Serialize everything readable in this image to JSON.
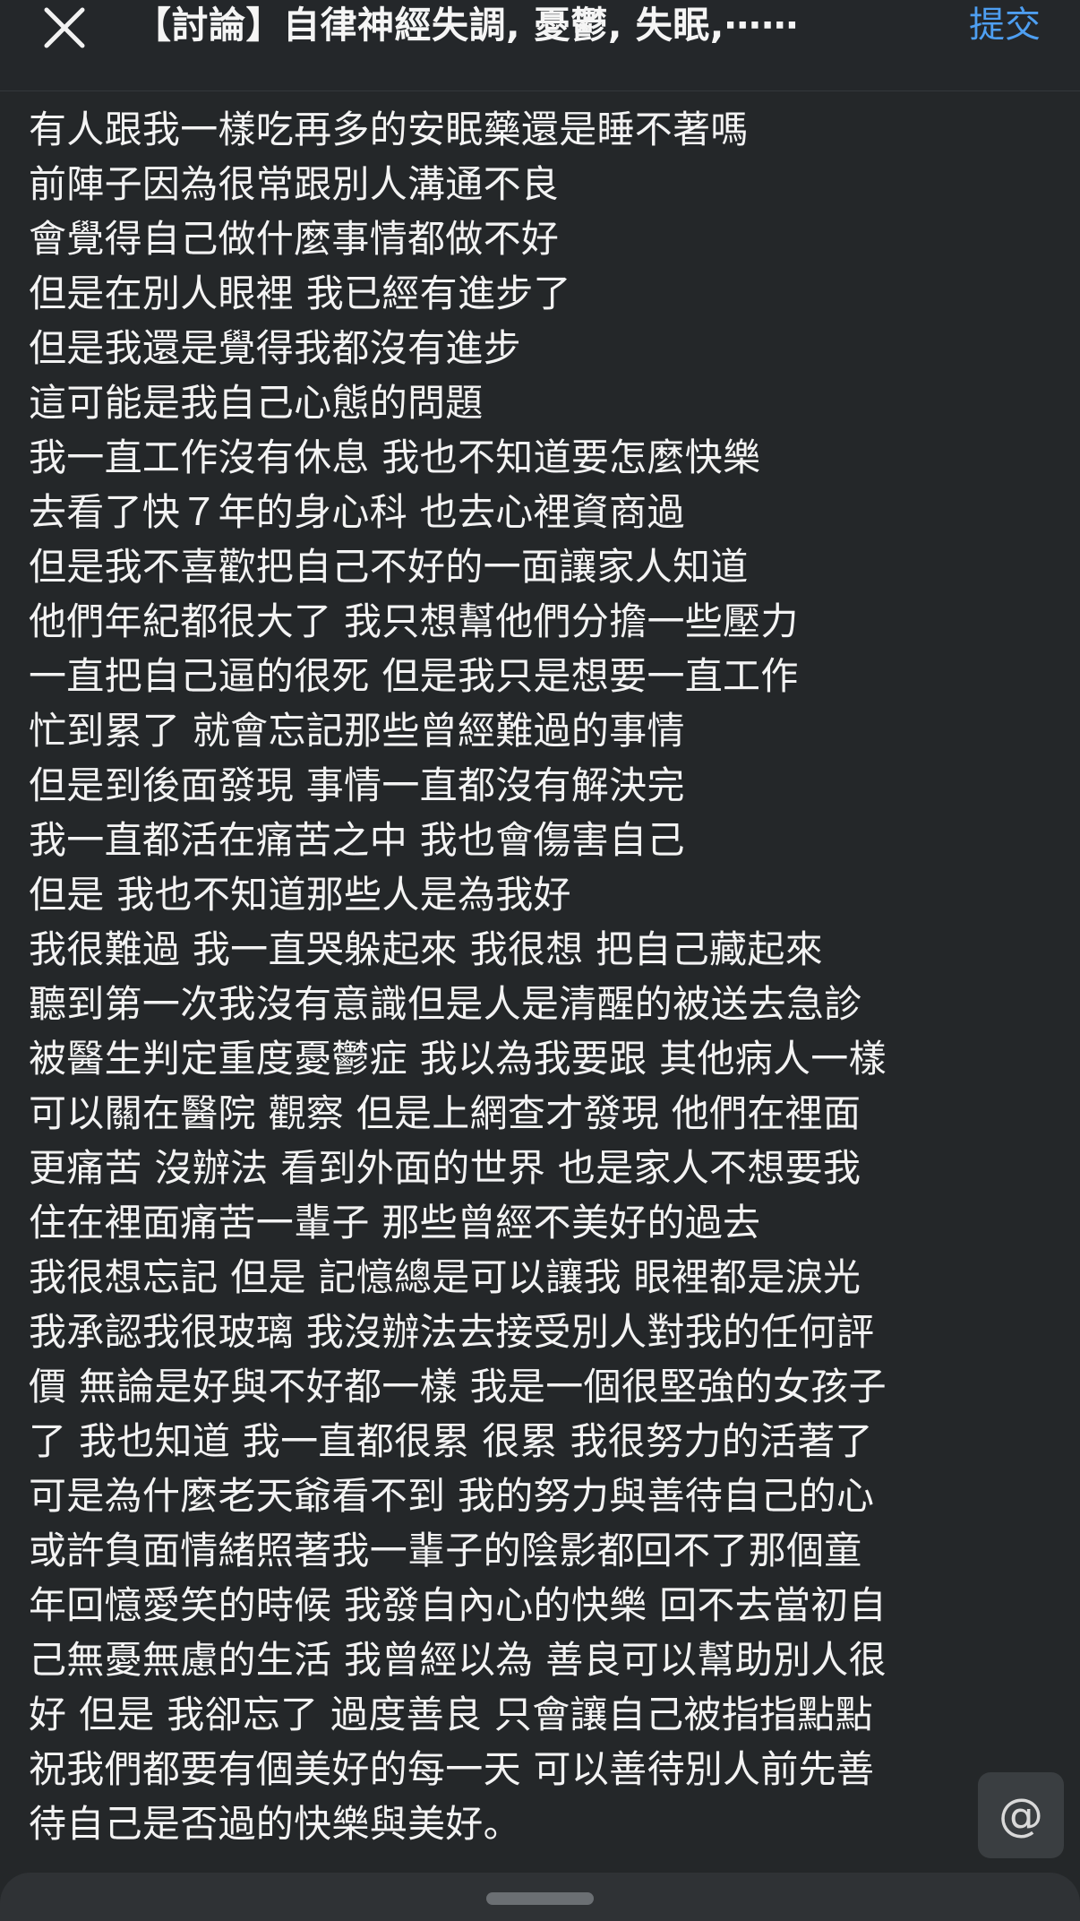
{
  "header": {
    "title": "【討論】自律神經失調, 憂鬱, 失眠,⋯⋯",
    "submit_label": "提交",
    "close_icon": "close-icon"
  },
  "post": {
    "lines": [
      "有人跟我一樣吃再多的安眠藥還是睡不著嗎",
      "前陣子因為很常跟別人溝通不良",
      "會覺得自己做什麼事情都做不好",
      "但是在別人眼裡 我已經有進步了",
      "但是我還是覺得我都沒有進步",
      "這可能是我自己心態的問題",
      "我一直工作沒有休息 我也不知道要怎麼快樂",
      "去看了快７年的身心科 也去心裡資商過",
      "但是我不喜歡把自己不好的一面讓家人知道",
      "他們年紀都很大了 我只想幫他們分擔一些壓力",
      "一直把自己逼的很死 但是我只是想要一直工作",
      "忙到累了 就會忘記那些曾經難過的事情",
      "但是到後面發現 事情一直都沒有解決完",
      "我一直都活在痛苦之中 我也會傷害自己",
      "但是 我也不知道那些人是為我好",
      "我很難過 我一直哭躲起來 我很想 把自己藏起來",
      "聽到第一次我沒有意識但是人是清醒的被送去急診",
      "被醫生判定重度憂鬱症 我以為我要跟 其他病人一樣",
      "可以關在醫院 觀察 但是上網查才發現 他們在裡面",
      "更痛苦 沒辦法 看到外面的世界 也是家人不想要我",
      "住在裡面痛苦一輩子 那些曾經不美好的過去",
      "我很想忘記 但是 記憶總是可以讓我 眼裡都是淚光",
      "我承認我很玻璃 我沒辦法去接受別人對我的任何評",
      "價 無論是好與不好都一樣 我是一個很堅強的女孩子",
      "了 我也知道 我一直都很累 很累 我很努力的活著了",
      "可是為什麼老天爺看不到 我的努力與善待自己的心",
      "或許負面情緒照著我一輩子的陰影都回不了那個童",
      "年回憶愛笑的時候 我發自內心的快樂 回不去當初自",
      "己無憂無慮的生活 我曾經以為 善良可以幫助別人很",
      "好 但是 我卻忘了 過度善良 只會讓自己被指指點點",
      "祝我們都要有個美好的每一天 可以善待別人前先善",
      "待自己是否過的快樂與美好。"
    ]
  },
  "mention": {
    "glyph": "@",
    "icon": "at-icon"
  },
  "colors": {
    "background": "#242729",
    "text": "#f3f3f3",
    "accent": "#4e9ff2"
  }
}
